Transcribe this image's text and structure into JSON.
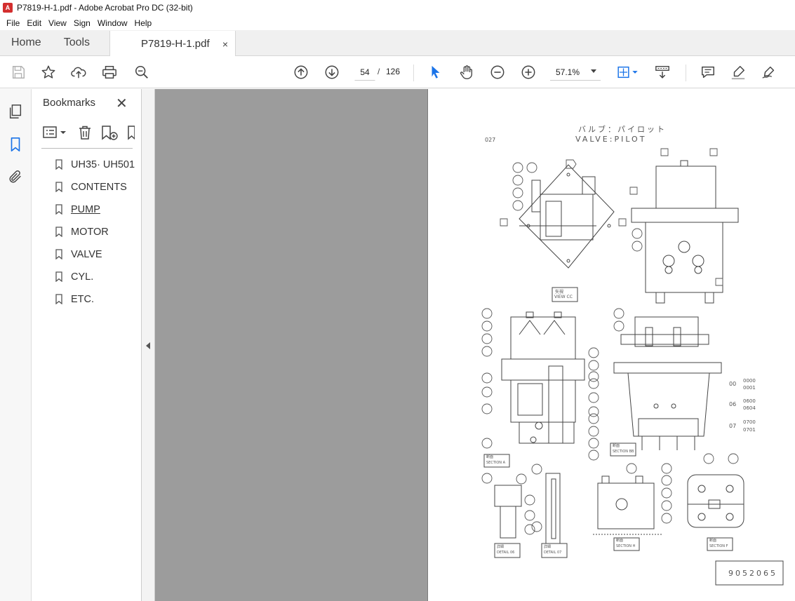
{
  "window": {
    "title": "P7819-H-1.pdf - Adobe Acrobat Pro DC (32-bit)"
  },
  "menu": [
    "File",
    "Edit",
    "View",
    "Sign",
    "Window",
    "Help"
  ],
  "tabs": {
    "home": "Home",
    "tools": "Tools",
    "document": "P7819-H-1.pdf",
    "close_symbol": "×"
  },
  "toolbar": {
    "page_current": "54",
    "page_separator": "/",
    "page_total": "126",
    "zoom": "57.1%",
    "icons": [
      "save-icon",
      "star-icon",
      "upload-icon",
      "print-icon",
      "zoom-search-icon",
      "page-up-icon",
      "page-down-icon",
      "select-cursor-icon",
      "hand-icon",
      "zoom-out-icon",
      "zoom-in-icon",
      "fit-page-icon",
      "scroll-mode-icon",
      "comment-icon",
      "highlight-icon",
      "sign-icon"
    ]
  },
  "bookmarks": {
    "title": "Bookmarks",
    "close_symbol": "✕",
    "items": [
      {
        "label": "UH35· UH501"
      },
      {
        "label": "CONTENTS"
      },
      {
        "label": "PUMP",
        "active": true
      },
      {
        "label": "MOTOR"
      },
      {
        "label": "VALVE"
      },
      {
        "label": "CYL."
      },
      {
        "label": "ETC."
      }
    ]
  },
  "document_page": {
    "page_code": "027",
    "title_jp": "バルブ：パイロット",
    "title_en": "VALVE:PILOT",
    "view_label_jp": "矢視",
    "view_label": "VIEW CC",
    "section_a": "SECTION A",
    "section_bb": "SECTION BB",
    "section_h": "SECTION H",
    "section_f": "SECTION F",
    "detail_06": "DETAIL 06",
    "detail_07": "DETAIL 07",
    "section_jp": "断面",
    "detail_jp": "詳細",
    "part_groups": [
      {
        "group": "00",
        "parts": [
          "0000",
          "0001"
        ]
      },
      {
        "group": "06",
        "parts": [
          "0600",
          "0604"
        ]
      },
      {
        "group": "07",
        "parts": [
          "0700",
          "0701"
        ]
      }
    ],
    "drawing_number": "9052065"
  }
}
